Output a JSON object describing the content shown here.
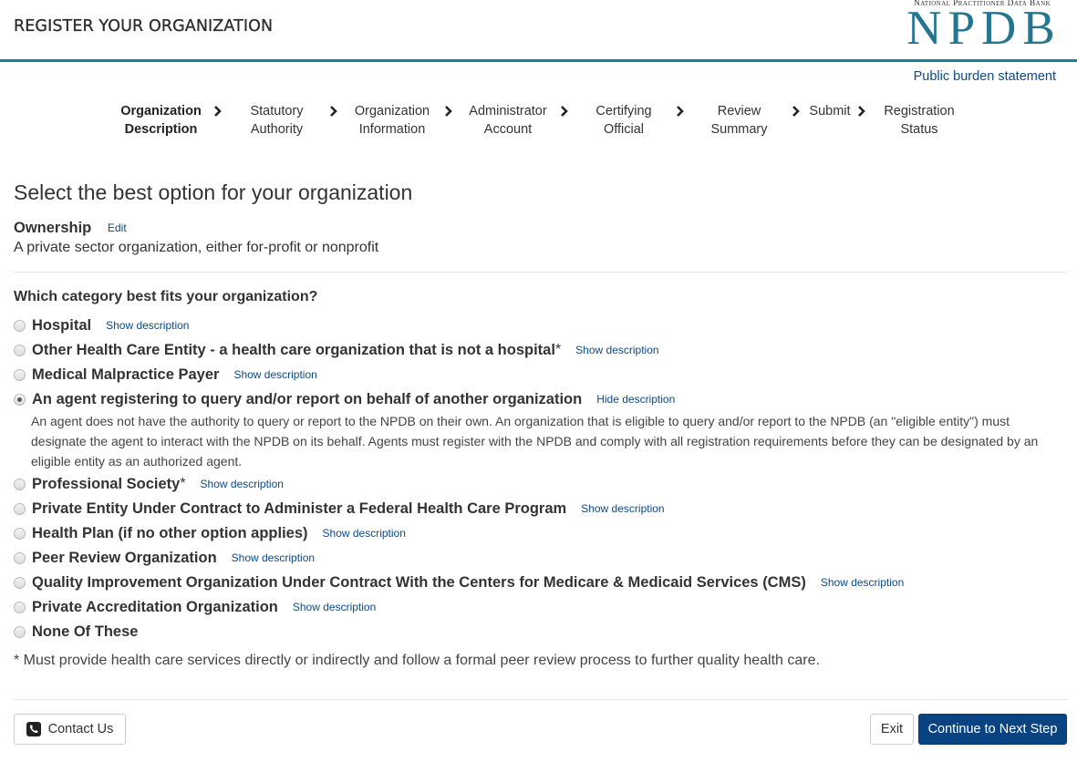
{
  "header": {
    "title": "REGISTER YOUR ORGANIZATION",
    "logo_subtitle": "National Practitioner Data Bank",
    "logo_main": "NPDB",
    "accent_color": "#1a7f92"
  },
  "links": {
    "public_burden": "Public burden statement"
  },
  "steps": [
    {
      "line1": "Organization",
      "line2": "Description",
      "active": true
    },
    {
      "line1": "Statutory",
      "line2": "Authority",
      "active": false
    },
    {
      "line1": "Organization",
      "line2": "Information",
      "active": false
    },
    {
      "line1": "Administrator",
      "line2": "Account",
      "active": false
    },
    {
      "line1": "Certifying",
      "line2": "Official",
      "active": false
    },
    {
      "line1": "Review",
      "line2": "Summary",
      "active": false
    },
    {
      "line1": "Submit",
      "line2": "",
      "active": false
    },
    {
      "line1": "Registration",
      "line2": "Status",
      "active": false
    }
  ],
  "main": {
    "heading": "Select the best option for your organization",
    "ownership": {
      "label": "Ownership",
      "edit_label": "Edit",
      "value": "A private sector organization, either for-profit or nonprofit"
    },
    "question": "Which category best fits your organization?",
    "options": [
      {
        "label": "Hospital",
        "asterisk": "",
        "link": "Show description",
        "selected": false
      },
      {
        "label": "Other Health Care Entity - a health care organization that is not a hospital",
        "asterisk": "*",
        "link": "Show description",
        "selected": false
      },
      {
        "label": "Medical Malpractice Payer",
        "asterisk": "",
        "link": "Show description",
        "selected": false
      },
      {
        "label": "An agent registering to query and/or report on behalf of another organization",
        "asterisk": "",
        "link": "Hide description",
        "selected": true,
        "description": "An agent does not have the authority to query or report to the NPDB on their own. An organization that is eligible to query and/or report to the NPDB (an \"eligible entity\") must designate the agent to interact with the NPDB on its behalf. Agents must register with the NPDB and comply with all registration requirements before they can be designated by an eligible entity as an authorized agent."
      },
      {
        "label": "Professional Society",
        "asterisk": "*",
        "link": "Show description",
        "selected": false
      },
      {
        "label": "Private Entity Under Contract to Administer a Federal Health Care Program",
        "asterisk": "",
        "link": "Show description",
        "selected": false
      },
      {
        "label": "Health Plan (if no other option applies)",
        "asterisk": "",
        "link": "Show description",
        "selected": false
      },
      {
        "label": "Peer Review Organization",
        "asterisk": "",
        "link": "Show description",
        "selected": false
      },
      {
        "label": "Quality Improvement Organization Under Contract With the Centers for Medicare & Medicaid Services (CMS)",
        "asterisk": "",
        "link": "Show description",
        "selected": false
      },
      {
        "label": "Private Accreditation Organization",
        "asterisk": "",
        "link": "Show description",
        "selected": false
      },
      {
        "label": "None Of These",
        "asterisk": "",
        "link": "",
        "selected": false
      }
    ],
    "footnote": "* Must provide health care services directly or indirectly and follow a formal peer review process to further quality health care."
  },
  "footer": {
    "contact_label": "Contact Us",
    "contact_icon": "phone-icon",
    "exit_label": "Exit",
    "next_label": "Continue to Next Step",
    "primary_color": "#0a4382"
  }
}
